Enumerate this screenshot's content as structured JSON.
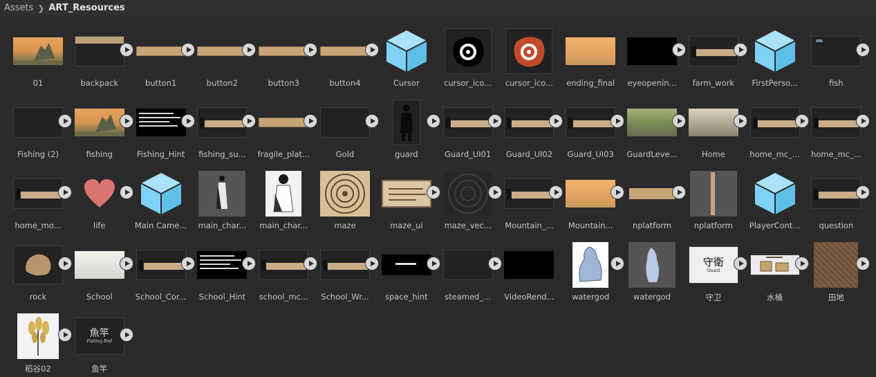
{
  "breadcrumb": {
    "root": "Assets",
    "current": "ART_Resources"
  },
  "colors": {
    "background": "#2a2a2a",
    "prefab_cube": "#7fd1f6",
    "label": "#c4c4c4"
  },
  "assets": [
    {
      "name": "01",
      "kind": "landscape-image",
      "play": false
    },
    {
      "name": "backpack",
      "kind": "dark-panel-bar",
      "play": true
    },
    {
      "name": "button1",
      "kind": "tan-button",
      "play": true
    },
    {
      "name": "button2",
      "kind": "tan-button",
      "play": true
    },
    {
      "name": "button3",
      "kind": "tan-button",
      "play": true
    },
    {
      "name": "button4",
      "kind": "tan-button",
      "play": true
    },
    {
      "name": "Cursor",
      "kind": "prefab-cube-icon",
      "play": false
    },
    {
      "name": "cursor_ico...",
      "kind": "cursor-icon-black",
      "play": false
    },
    {
      "name": "cursor_ico...",
      "kind": "cursor-icon-red",
      "play": false
    },
    {
      "name": "ending_final",
      "kind": "landscape-pale-image",
      "play": false
    },
    {
      "name": "eyeopenin...",
      "kind": "black-video",
      "play": true
    },
    {
      "name": "farm_work",
      "kind": "dialog-panel",
      "play": true
    },
    {
      "name": "FirstPerso...",
      "kind": "prefab-cube-icon",
      "play": false
    },
    {
      "name": "fish",
      "kind": "dark-panel-fish",
      "play": true
    },
    {
      "name": "Fishing (2)",
      "kind": "dark-panel",
      "play": true
    },
    {
      "name": "fishing",
      "kind": "landscape-image",
      "play": true
    },
    {
      "name": "Fishing_Hint",
      "kind": "black-text",
      "play": true
    },
    {
      "name": "fishing_su...",
      "kind": "dialog-panel",
      "play": true
    },
    {
      "name": "fragile_plat...",
      "kind": "tan-button",
      "play": true
    },
    {
      "name": "Gold",
      "kind": "dark-panel",
      "play": true
    },
    {
      "name": "guard",
      "kind": "guard-figure",
      "play": true
    },
    {
      "name": "Guard_UI01",
      "kind": "dialog-panel",
      "play": true
    },
    {
      "name": "Guard_UI02",
      "kind": "dialog-panel",
      "play": true
    },
    {
      "name": "Guard_UI03",
      "kind": "dialog-panel",
      "play": true
    },
    {
      "name": "GuardLeve...",
      "kind": "guardlevel-image",
      "play": true
    },
    {
      "name": "Home",
      "kind": "home-image",
      "play": true
    },
    {
      "name": "home_mc_...",
      "kind": "dialog-panel",
      "play": true
    },
    {
      "name": "home_mc_...",
      "kind": "dialog-panel",
      "play": true
    },
    {
      "name": "home_mo...",
      "kind": "dialog-panel",
      "play": true
    },
    {
      "name": "life",
      "kind": "heart-icon",
      "play": true
    },
    {
      "name": "Main Came...",
      "kind": "prefab-cube-icon",
      "play": false
    },
    {
      "name": "main_char...",
      "kind": "character-gray",
      "play": false
    },
    {
      "name": "main_char...",
      "kind": "character-white",
      "play": false
    },
    {
      "name": "maze",
      "kind": "maze-image",
      "play": false
    },
    {
      "name": "maze_ui",
      "kind": "parchment-scroll",
      "play": true
    },
    {
      "name": "maze_vec...",
      "kind": "maze-dark",
      "play": true
    },
    {
      "name": "Mountain_...",
      "kind": "dialog-panel",
      "play": true
    },
    {
      "name": "Mountain...",
      "kind": "landscape-pale-image",
      "play": true
    },
    {
      "name": "nplatform",
      "kind": "tan-plank",
      "play": true
    },
    {
      "name": "nplatform",
      "kind": "gray-door",
      "play": false
    },
    {
      "name": "PlayerCont...",
      "kind": "prefab-cube-icon",
      "play": false
    },
    {
      "name": "question",
      "kind": "dialog-panel",
      "play": true
    },
    {
      "name": "rock",
      "kind": "rock-icon",
      "play": true
    },
    {
      "name": "School",
      "kind": "school-image",
      "play": true
    },
    {
      "name": "School_Cor...",
      "kind": "dialog-panel",
      "play": true
    },
    {
      "name": "School_Hint",
      "kind": "black-text",
      "play": true
    },
    {
      "name": "school_mc...",
      "kind": "dialog-panel",
      "play": true
    },
    {
      "name": "School_Wr...",
      "kind": "dialog-panel",
      "play": true
    },
    {
      "name": "space_hint",
      "kind": "black-small-text",
      "play": true
    },
    {
      "name": "steamed_...",
      "kind": "dark-panel",
      "play": true
    },
    {
      "name": "VideoRend...",
      "kind": "black-video",
      "play": false
    },
    {
      "name": "watergod",
      "kind": "watergod-figure",
      "play": true
    },
    {
      "name": "watergod",
      "kind": "watergod-gray",
      "play": false
    },
    {
      "name": "守卫",
      "kind": "calligraphy-guard",
      "play": true
    },
    {
      "name": "水桶",
      "kind": "bucket-image",
      "play": true
    },
    {
      "name": "田地",
      "kind": "field-texture",
      "play": true
    },
    {
      "name": "稻谷02",
      "kind": "rice-plant",
      "play": true
    },
    {
      "name": "鱼竿",
      "kind": "calligraphy-rod",
      "play": true
    }
  ],
  "thumb_text": {
    "guard_calligraphy": "守衛",
    "guard_caption": "Guard",
    "rod_calligraphy": "魚竿",
    "rod_caption": "Fishing Rod"
  }
}
